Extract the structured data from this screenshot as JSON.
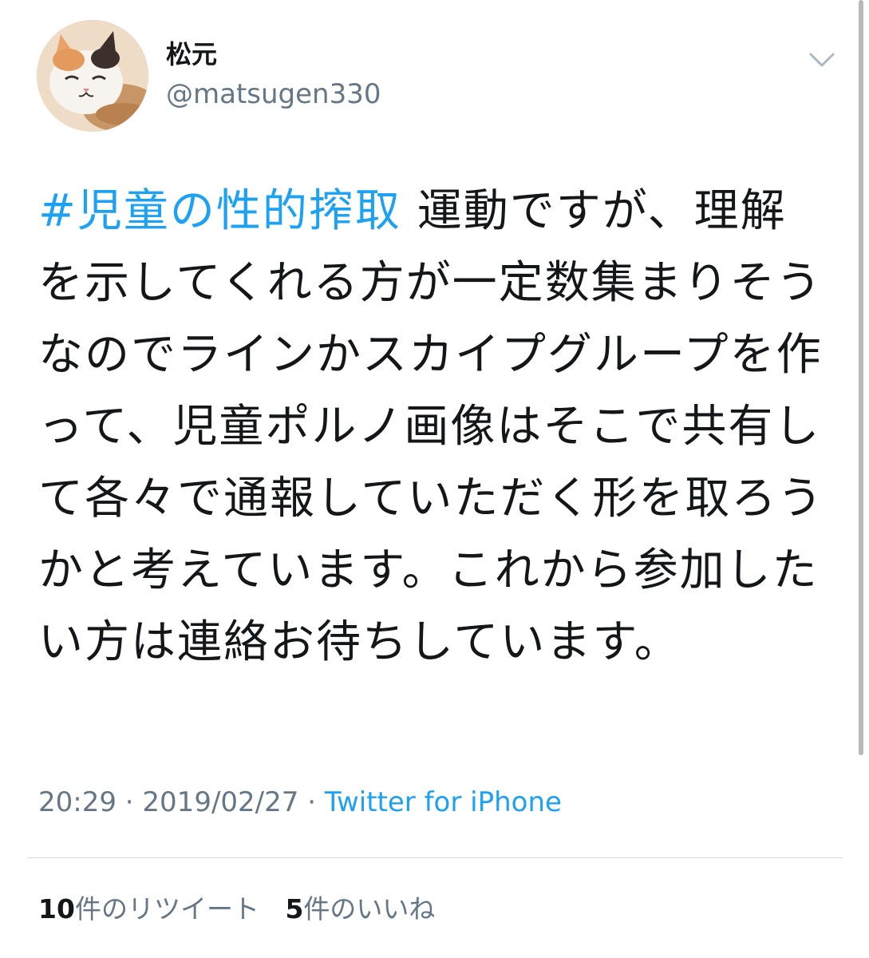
{
  "author": {
    "display_name": "松元",
    "handle": "@matsugen330",
    "avatar_icon": "cat-avatar-icon"
  },
  "menu_icon": "chevron-down-icon",
  "tweet": {
    "hashtag": "#児童の性的搾取",
    "text": " 運動ですが、理解を示してくれる方が一定数集まりそうなのでラインかスカイプグループを作って、児童ポルノ画像はそこで共有して各々で通報していただく形を取ろうかと考えています。これから参加したい方は連絡お待ちしています。"
  },
  "meta": {
    "time": "20:29",
    "separator": " · ",
    "date": "2019/02/27",
    "source": "Twitter for iPhone"
  },
  "stats": {
    "retweets_count": "10",
    "retweets_label": "件のリツイート",
    "likes_count": "5",
    "likes_label": "件のいいね"
  },
  "colors": {
    "link": "#1da1f2",
    "text": "#14171a",
    "muted": "#657786",
    "divider": "#d5dbe0"
  }
}
